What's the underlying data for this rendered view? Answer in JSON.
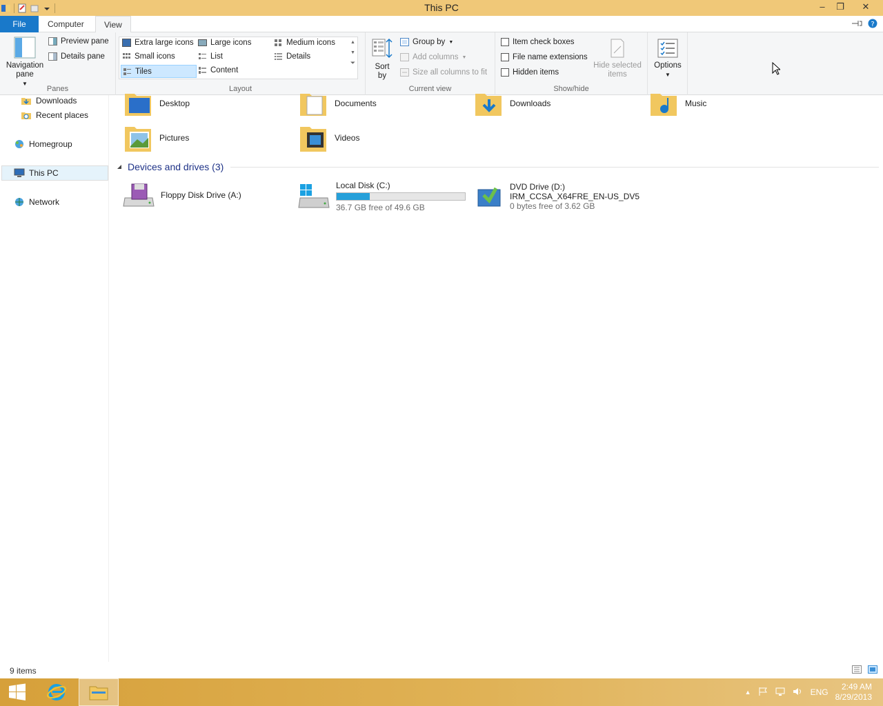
{
  "window": {
    "title": "This PC",
    "controls": {
      "minimize": "–",
      "maximize": "❐",
      "close": "✕"
    }
  },
  "ribbon": {
    "tabs": [
      "File",
      "Computer",
      "View"
    ],
    "active_tab": "View",
    "panes": {
      "label": "Panes",
      "navigation_pane": "Navigation pane",
      "preview_pane": "Preview pane",
      "details_pane": "Details pane"
    },
    "layout": {
      "label": "Layout",
      "options": [
        "Extra large icons",
        "Large icons",
        "Medium icons",
        "Small icons",
        "List",
        "Details",
        "Tiles",
        "Content"
      ],
      "selected": "Tiles"
    },
    "current_view": {
      "label": "Current view",
      "sort_by": "Sort by",
      "group_by": "Group by",
      "add_columns": "Add columns",
      "size_all_columns": "Size all columns to fit"
    },
    "show_hide": {
      "label": "Show/hide",
      "item_check_boxes": "Item check boxes",
      "file_name_extensions": "File name extensions",
      "hidden_items": "Hidden items",
      "hide_selected_items": "Hide selected items"
    },
    "options": "Options"
  },
  "nav_pane": {
    "items": [
      "Downloads",
      "Recent places",
      "Homegroup",
      "This PC",
      "Network"
    ],
    "selected": "This PC"
  },
  "content": {
    "folders": [
      "Desktop",
      "Documents",
      "Downloads",
      "Music",
      "Pictures",
      "Videos"
    ],
    "devices_group": "Devices and drives (3)",
    "drives": [
      {
        "name": "Floppy Disk Drive (A:)",
        "detail": "",
        "free": ""
      },
      {
        "name": "Local Disk (C:)",
        "free": "36.7 GB free of 49.6 GB",
        "used_fraction": 0.26
      },
      {
        "name": "DVD Drive (D:)",
        "detail": "IRM_CCSA_X64FRE_EN-US_DV5",
        "free": "0 bytes free of 3.62 GB"
      }
    ]
  },
  "status": {
    "count": "9 items"
  },
  "taskbar": {
    "tray_lang": "ENG",
    "time": "2:49 AM",
    "date": "8/29/2013"
  },
  "colors": {
    "titlebar": "#f0c878",
    "file_tab": "#1979ca",
    "progress_fill": "#26a0da",
    "group_header": "#1e3287"
  }
}
